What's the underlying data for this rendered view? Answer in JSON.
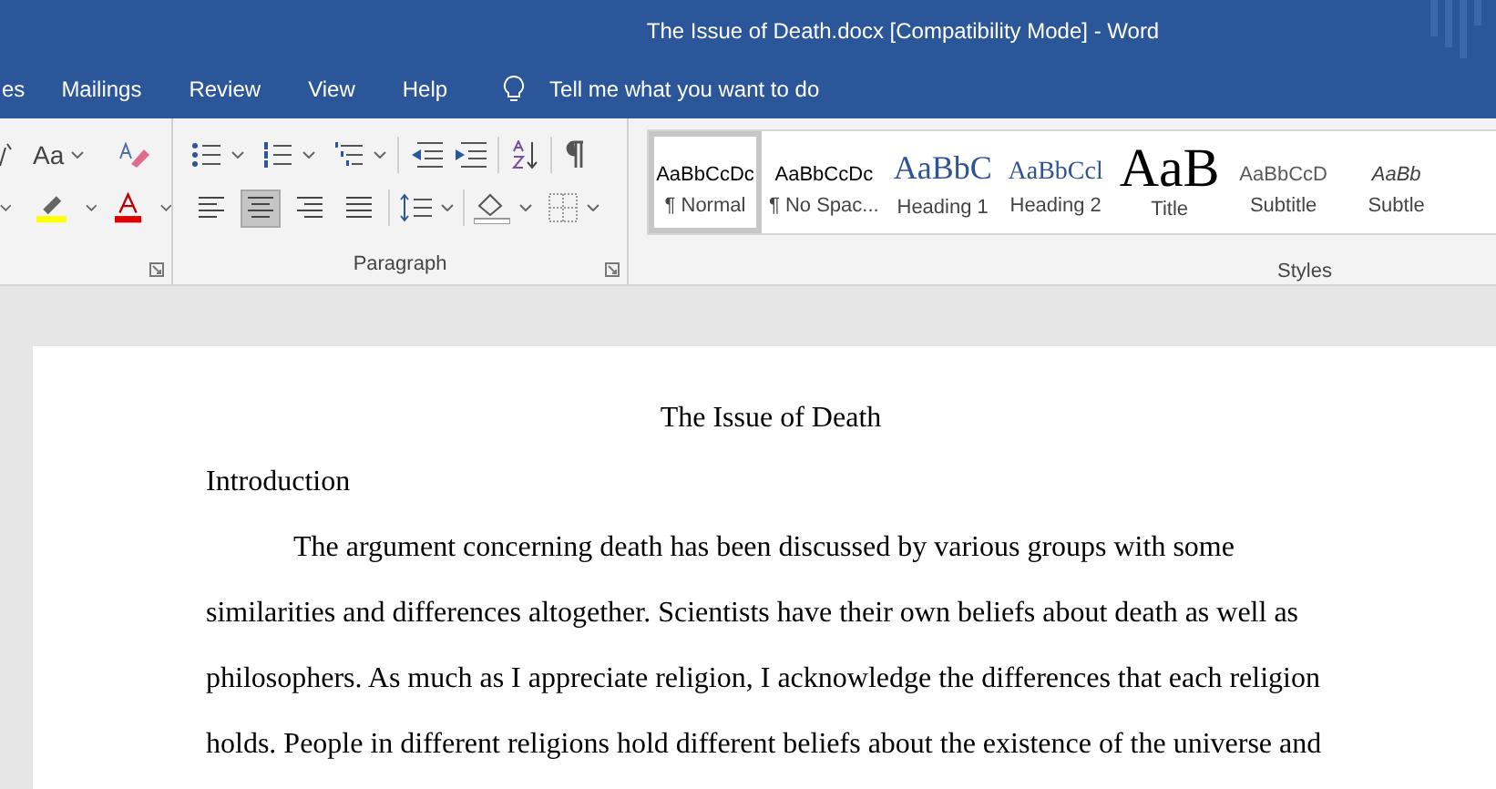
{
  "window": {
    "title": "The Issue of Death.docx [Compatibility Mode]  -  Word"
  },
  "tabs": [
    {
      "label": "es",
      "selected": false
    },
    {
      "label": "Mailings",
      "selected": false
    },
    {
      "label": "Review",
      "selected": false
    },
    {
      "label": "View",
      "selected": false
    },
    {
      "label": "Help",
      "selected": false
    }
  ],
  "tell_me": {
    "placeholder": "Tell me what you want to do"
  },
  "font_group": {
    "change_case": "Aa"
  },
  "paragraph_group": {
    "label": "Paragraph",
    "align": [
      {
        "kind": "left",
        "selected": false
      },
      {
        "kind": "center",
        "selected": true
      },
      {
        "kind": "right",
        "selected": false
      },
      {
        "kind": "justify",
        "selected": false
      }
    ]
  },
  "styles_group": {
    "label": "Styles",
    "styles": [
      {
        "sample": "AaBbCcDc",
        "name": "¶ Normal",
        "kind": "normal",
        "selected": true
      },
      {
        "sample": "AaBbCcDc",
        "name": "¶ No Spac...",
        "kind": "normal",
        "selected": false
      },
      {
        "sample": "AaBbC",
        "name": "Heading 1",
        "kind": "heading1",
        "selected": false
      },
      {
        "sample": "AaBbCcl",
        "name": "Heading 2",
        "kind": "heading2",
        "selected": false
      },
      {
        "sample": "AaB",
        "name": "Title",
        "kind": "title",
        "selected": false
      },
      {
        "sample": "AaBbCcD",
        "name": "Subtitle",
        "kind": "subtitle",
        "selected": false
      },
      {
        "sample": "AaBb",
        "name": "Subtle",
        "kind": "subtle",
        "selected": false
      }
    ]
  },
  "document": {
    "title": "The Issue of Death",
    "heading": "Introduction",
    "paragraph": "The argument concerning death has been discussed by various groups with some similarities and differences altogether. Scientists have their own beliefs about death as well as philosophers. As much as I appreciate religion, I acknowledge the differences that each religion holds. People in different religions hold different beliefs about the existence of the universe and"
  }
}
